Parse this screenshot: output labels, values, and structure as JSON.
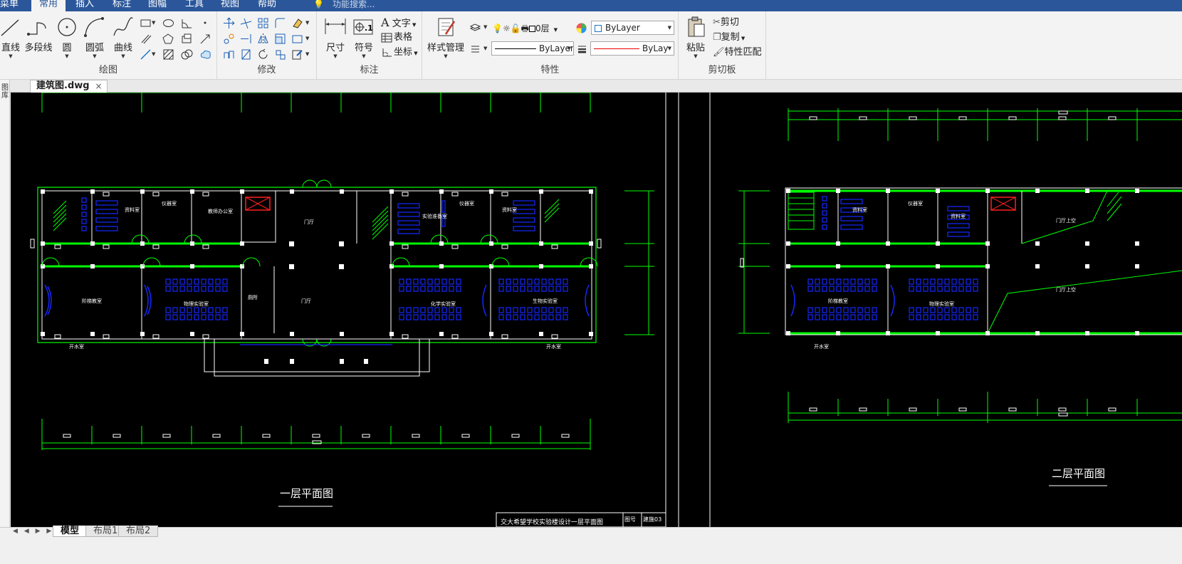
{
  "menu": {
    "items": [
      "菜单",
      "常用",
      "插入",
      "标注",
      "图幅",
      "工具",
      "视图",
      "帮助"
    ],
    "active_index": 1,
    "search_placeholder": "功能搜索..."
  },
  "ribbon": {
    "groups": {
      "draw": "绘图",
      "modify": "修改",
      "annotate": "标注",
      "properties": "特性",
      "clipboard": "剪切板"
    },
    "draw_tools": [
      "直线",
      "多段线",
      "圆",
      "圆弧",
      "曲线"
    ],
    "annotate_tools": {
      "dimension": "尺寸",
      "symbol": "符号",
      "text": "文字",
      "table": "表格",
      "coordinate": "坐标"
    },
    "style_manager": "样式管理",
    "layer_value": "0层",
    "color_value": "ByLayer",
    "linetype_value": "ByLayer",
    "lineweight_value": "ByLay",
    "clipboard": {
      "paste": "粘贴",
      "cut": "剪切",
      "copy": "复制",
      "match": "特性匹配"
    }
  },
  "document": {
    "tab_label": "建筑图.dwg",
    "close_glyph": "×"
  },
  "left_strip_label": "图库",
  "drawing": {
    "sheet1_title": "一层平面图",
    "sheet2_title": "二层平面图",
    "title_block_text": "交大希望学校实验楼设计一层平面图",
    "title_block_drawing_no_label": "图号",
    "title_block_drawing_no": "建施03",
    "rooms": {
      "lobby": "门厅",
      "restroom": "厕所",
      "teacher_office": "教师办公室",
      "lab_prep": "实验准备室",
      "library": "资料室",
      "lecture_hall": "阶梯教室",
      "lab": "物理实验室",
      "lab2": "化学实验室",
      "bio_lab": "生物实验室",
      "store": "仪器室",
      "water": "开水室",
      "lobby_upper": "门厅上空"
    }
  },
  "bottom": {
    "layout_tabs": [
      "模型",
      "布局1",
      "布局2"
    ],
    "active_tab_index": 0
  },
  "colors": {
    "menu_bg": "#2b579a",
    "canvas_bg": "#000000",
    "wall_green": "#00ff00",
    "furniture_blue": "#1428ff",
    "stair_red": "#ff2020"
  }
}
